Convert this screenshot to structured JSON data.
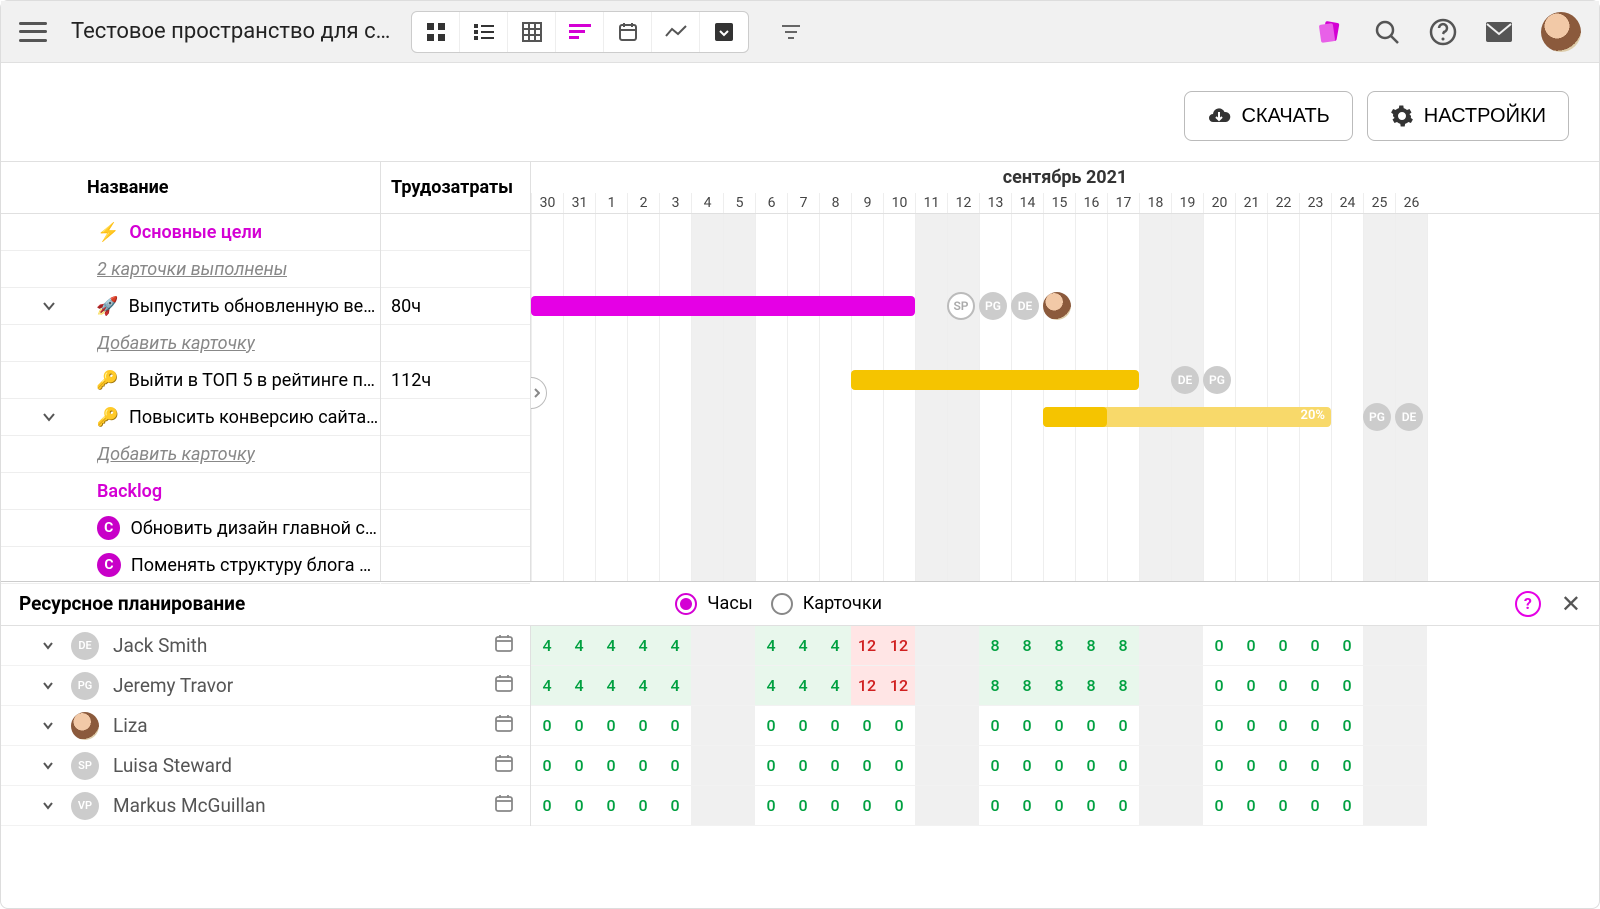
{
  "topbar": {
    "space_title": "Тестовое пространство для с…",
    "views": [
      "dashboard",
      "list",
      "table",
      "gantt",
      "calendar",
      "reports",
      "archive"
    ],
    "active_view_index": 3
  },
  "actionbar": {
    "download": "СКАЧАТЬ",
    "settings": "НАСТРОЙКИ"
  },
  "gantt": {
    "header_name": "Название",
    "header_effort": "Трудозатраты",
    "month_label": "сентябрь 2021",
    "days": [
      30,
      31,
      1,
      2,
      3,
      4,
      5,
      6,
      7,
      8,
      9,
      10,
      11,
      12,
      13,
      14,
      15,
      16,
      17,
      18,
      19,
      20,
      21,
      22,
      23,
      24,
      25,
      26
    ],
    "weekend_indices": [
      [
        5,
        6
      ],
      [
        12,
        13
      ],
      [
        19,
        20
      ],
      [
        26,
        27
      ]
    ],
    "rows": [
      {
        "type": "section",
        "emoji": "⚡",
        "label": "Основные цели"
      },
      {
        "type": "done",
        "label": "2 карточки выполнены"
      },
      {
        "type": "task",
        "chev": true,
        "emoji": "🚀",
        "label": "Выпустить обновленную вер…",
        "effort": "80ч"
      },
      {
        "type": "add",
        "label": "Добавить карточку"
      },
      {
        "type": "task",
        "chev": false,
        "emoji": "🔑",
        "label": "Выйти в ТОП 5 в рейтинге по…",
        "effort": "112ч"
      },
      {
        "type": "task",
        "chev": true,
        "emoji": "🔑",
        "label": "Повысить конверсию сайта …",
        "effort": ""
      },
      {
        "type": "add",
        "label": "Добавить карточку"
      },
      {
        "type": "section",
        "emoji": "",
        "label": "Backlog"
      },
      {
        "type": "backlog",
        "badge": "C",
        "label": "Обновить дизайн главной ст…"
      },
      {
        "type": "backlog",
        "badge": "C",
        "label": "Поменять структуру блога 🔥"
      }
    ],
    "bars": [
      {
        "row": 2,
        "start": 0,
        "len": 12,
        "color": "magenta",
        "assignees": [
          "SP",
          "PG",
          "DE",
          "photo"
        ],
        "assignee_col": 13
      },
      {
        "row": 4,
        "start": 10,
        "len": 9,
        "color": "yellow",
        "assignees": [
          "DE",
          "PG"
        ],
        "assignee_col": 20
      },
      {
        "row": 5,
        "start": 16,
        "len": 9,
        "color": "yellow-light",
        "progress_len": 2,
        "pct": "20%",
        "assignees": [
          "PG",
          "DE"
        ],
        "assignee_col": 26
      }
    ]
  },
  "resource": {
    "title": "Ресурсное планирование",
    "mode_hours": "Часы",
    "mode_cards": "Карточки",
    "people": [
      {
        "initials": "DE",
        "name": "Jack Smith",
        "cells": [
          4,
          4,
          4,
          4,
          4,
          "",
          "",
          4,
          4,
          4,
          12,
          12,
          "",
          "",
          8,
          8,
          8,
          8,
          8,
          "",
          "",
          0,
          0,
          0,
          0,
          0,
          "",
          ""
        ]
      },
      {
        "initials": "PG",
        "name": "Jeremy Travor",
        "cells": [
          4,
          4,
          4,
          4,
          4,
          "",
          "",
          4,
          4,
          4,
          12,
          12,
          "",
          "",
          8,
          8,
          8,
          8,
          8,
          "",
          "",
          0,
          0,
          0,
          0,
          0,
          "",
          ""
        ]
      },
      {
        "initials": "photo",
        "name": "Liza",
        "cells": [
          0,
          0,
          0,
          0,
          0,
          "",
          "",
          0,
          0,
          0,
          0,
          0,
          "",
          "",
          0,
          0,
          0,
          0,
          0,
          "",
          "",
          0,
          0,
          0,
          0,
          0,
          "",
          ""
        ]
      },
      {
        "initials": "SP",
        "name": "Luisa Steward",
        "cells": [
          0,
          0,
          0,
          0,
          0,
          "",
          "",
          0,
          0,
          0,
          0,
          0,
          "",
          "",
          0,
          0,
          0,
          0,
          0,
          "",
          "",
          0,
          0,
          0,
          0,
          0,
          "",
          ""
        ]
      },
      {
        "initials": "VP",
        "name": "Markus McGuillan",
        "cells": [
          0,
          0,
          0,
          0,
          0,
          "",
          "",
          0,
          0,
          0,
          0,
          0,
          "",
          "",
          0,
          0,
          0,
          0,
          0,
          "",
          "",
          0,
          0,
          0,
          0,
          0,
          "",
          ""
        ]
      }
    ]
  }
}
